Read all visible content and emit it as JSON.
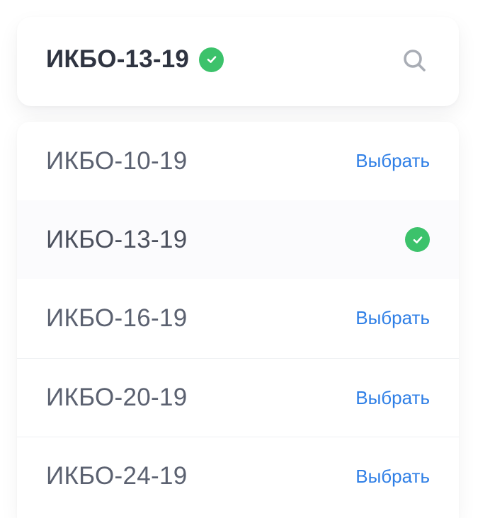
{
  "header": {
    "title": "ИКБО-13-19",
    "status_icon": "check-circle-icon",
    "search_icon": "search-icon"
  },
  "groups": [
    {
      "label": "ИКБО-10-19",
      "action": "Выбрать",
      "selected": false
    },
    {
      "label": "ИКБО-13-19",
      "action": "",
      "selected": true
    },
    {
      "label": "ИКБО-16-19",
      "action": "Выбрать",
      "selected": false
    },
    {
      "label": "ИКБО-20-19",
      "action": "Выбрать",
      "selected": false
    },
    {
      "label": "ИКБО-24-19",
      "action": "Выбрать",
      "selected": false
    }
  ],
  "colors": {
    "accent": "#2f7fe6",
    "success": "#3cc26b",
    "title_text": "#2f3441",
    "row_text": "#5b6170"
  }
}
